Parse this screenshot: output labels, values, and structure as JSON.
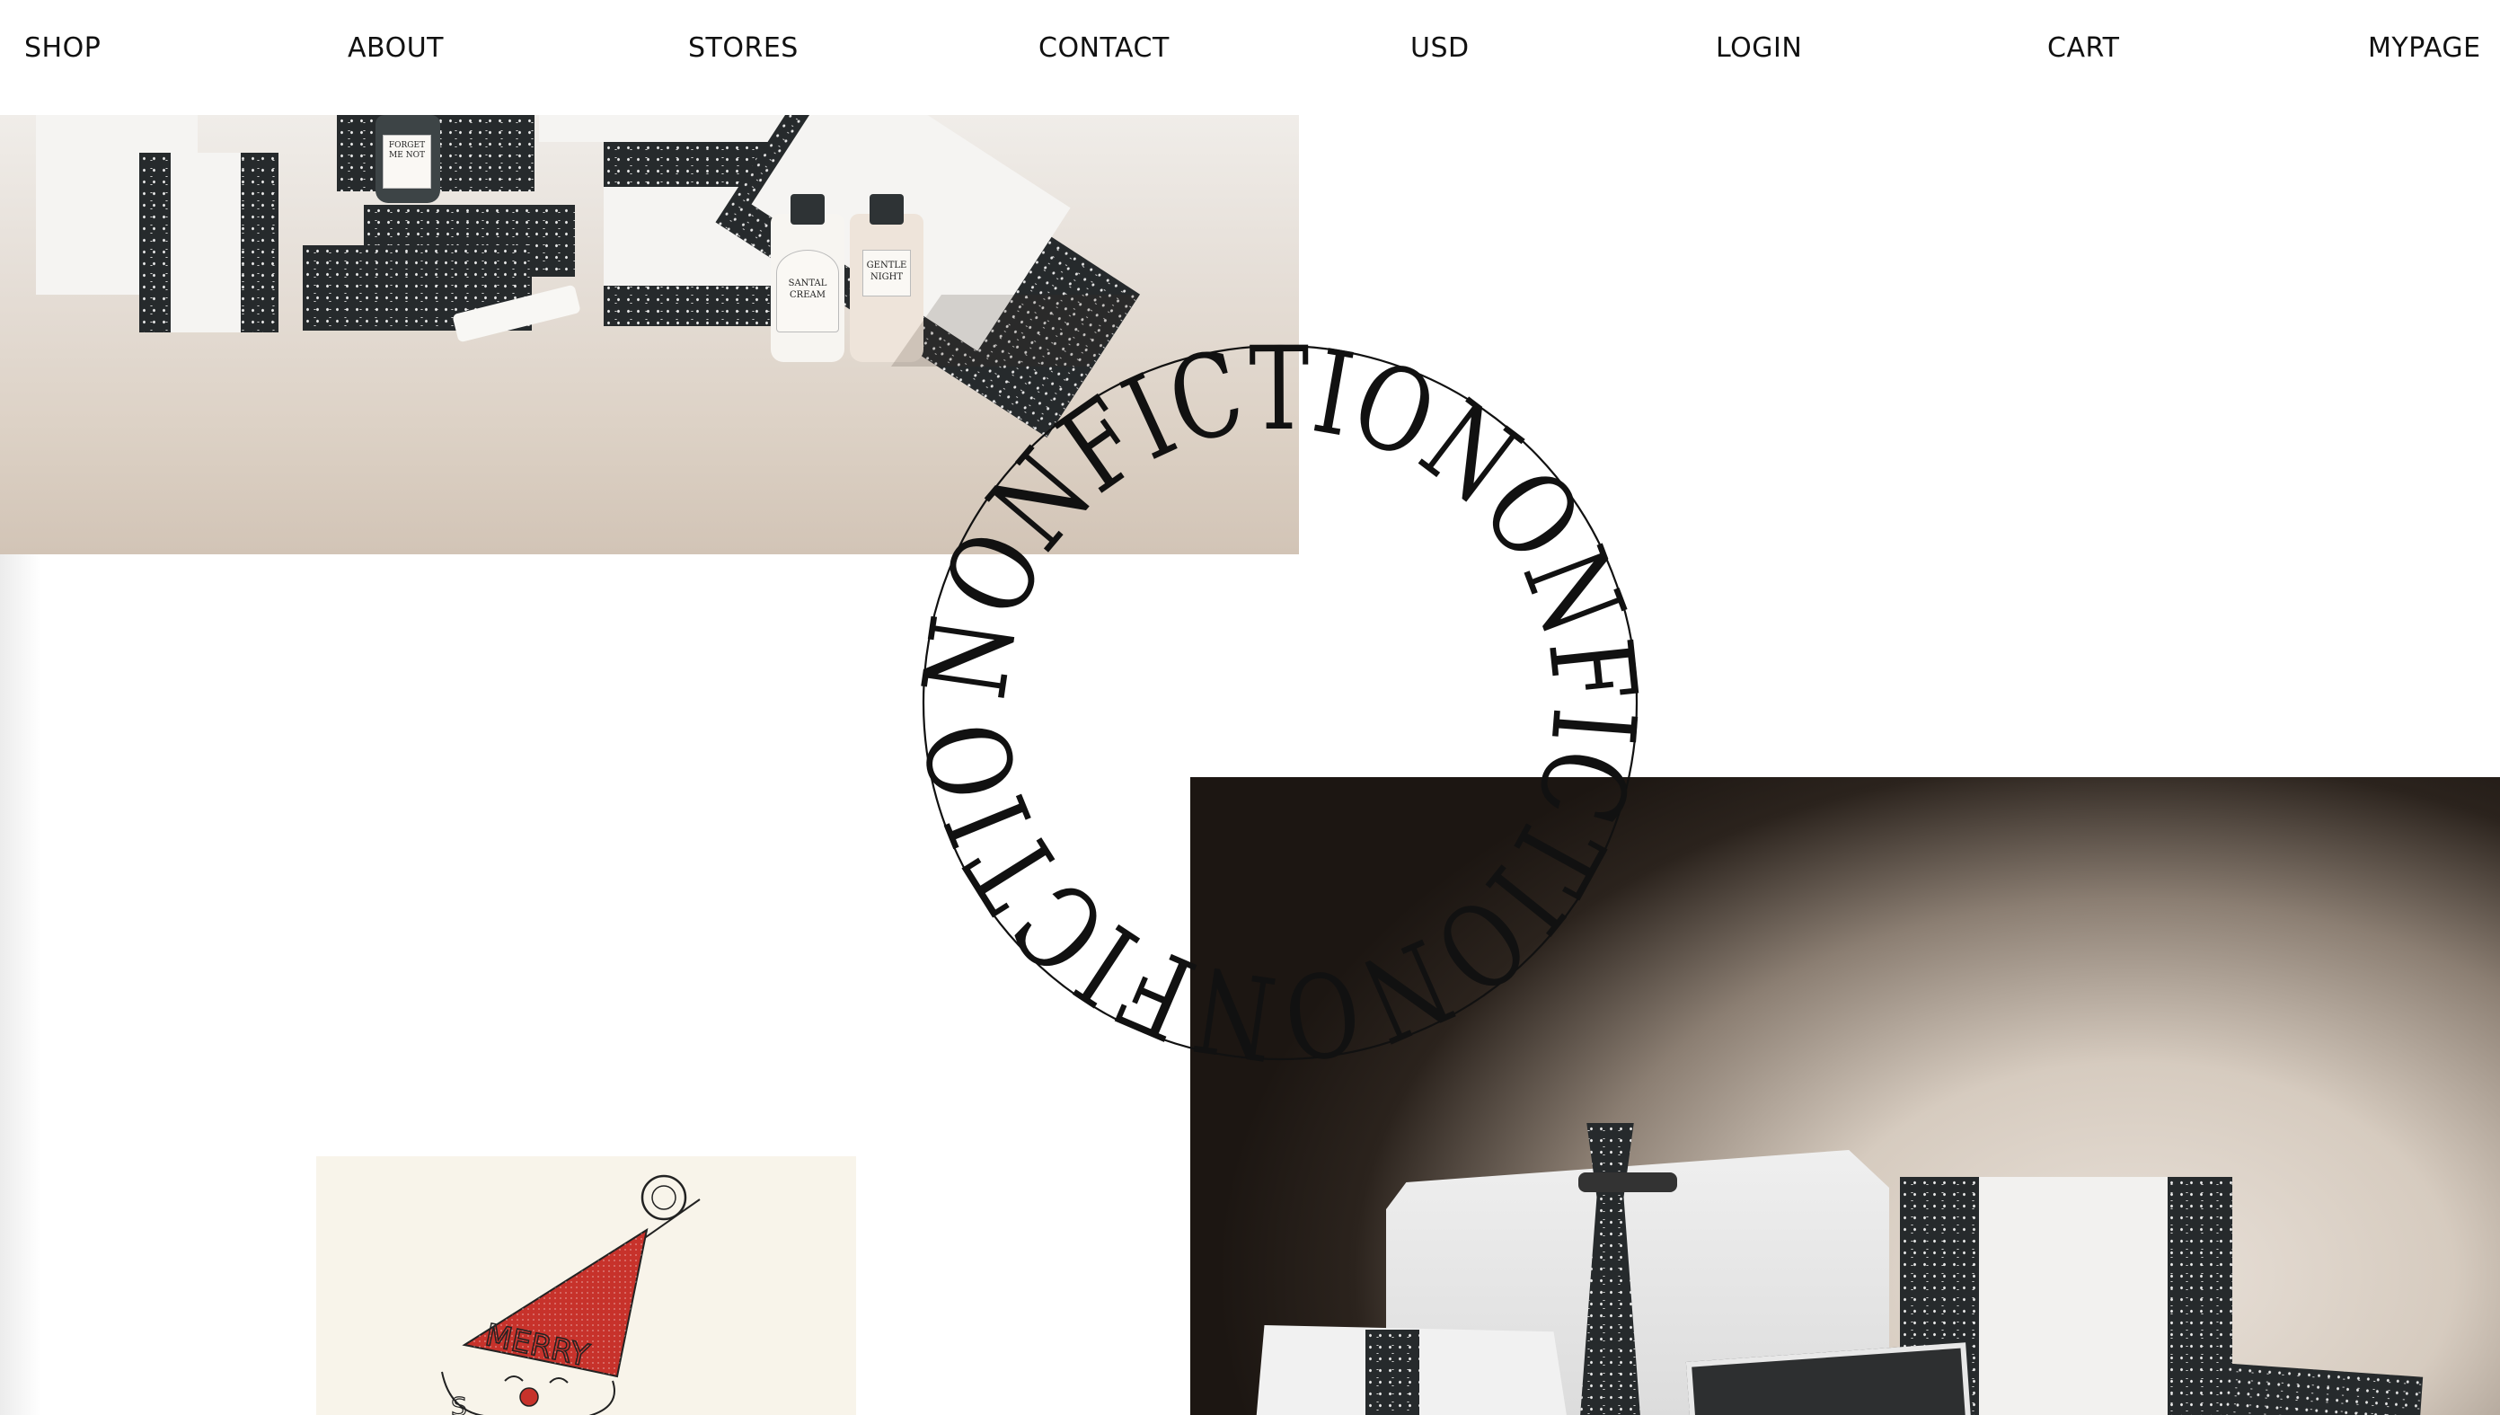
{
  "nav": {
    "shop": "SHOP",
    "about": "ABOUT",
    "stores": "STORES",
    "contact": "CONTACT",
    "currency": "USD",
    "login": "LOGIN",
    "cart": "CART",
    "mypage": "MYPAGE"
  },
  "brand": {
    "emblem_text": "NONFICTIONONFICTIONONFICTIO"
  },
  "images": {
    "top_photo": "nonfiction-product-lineup-photo",
    "bottom_photo": "nonfiction-gift-boxes-photo",
    "card_photo": "merry-christmas-clown-illustration"
  },
  "product_labels": {
    "bottle_1": [
      "FORGET",
      "ME NOT"
    ],
    "bottle_2": [
      "SANTAL",
      "CREAM"
    ],
    "bottle_3": [
      "GENTLE",
      "NIGHT"
    ]
  },
  "illustration_text": "MERRY",
  "colors": {
    "background": "#ffffff",
    "text": "#111111",
    "box_dark": "#262a2c",
    "beige": "#d8ccbf",
    "illustration_red": "#c7322b"
  }
}
